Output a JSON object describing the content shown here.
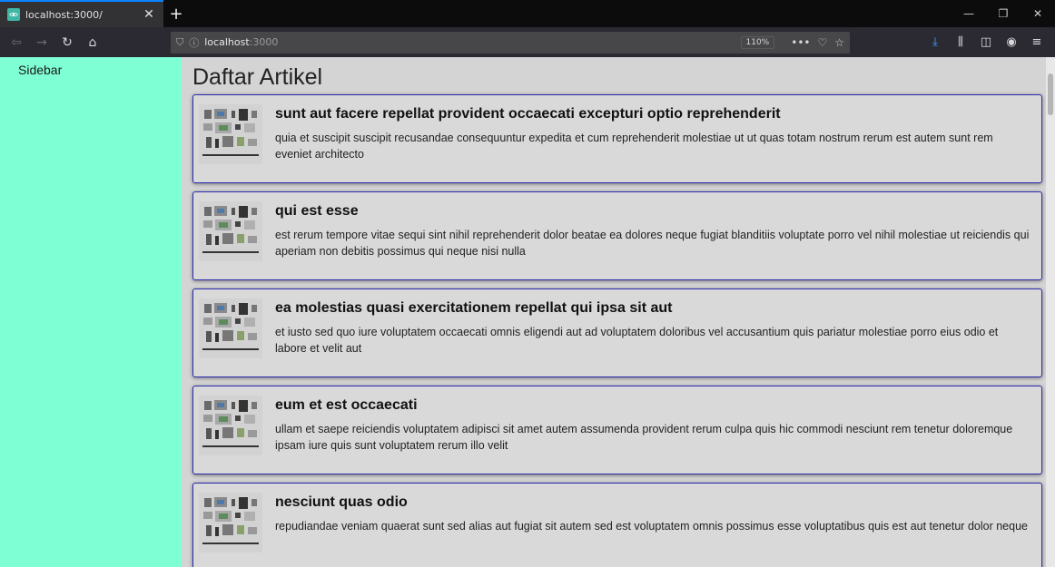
{
  "tab": {
    "title": "localhost:3000/"
  },
  "toolbar": {
    "url_host": "localhost",
    "url_port": ":3000",
    "zoom": "110%"
  },
  "sidebar": {
    "label": "Sidebar"
  },
  "page": {
    "title": "Daftar Artikel"
  },
  "articles": [
    {
      "title": "sunt aut facere repellat provident occaecati excepturi optio reprehenderit",
      "body": "quia et suscipit suscipit recusandae consequuntur expedita et cum reprehenderit molestiae ut ut quas totam nostrum rerum est autem sunt rem eveniet architecto"
    },
    {
      "title": "qui est esse",
      "body": "est rerum tempore vitae sequi sint nihil reprehenderit dolor beatae ea dolores neque fugiat blanditiis voluptate porro vel nihil molestiae ut reiciendis qui aperiam non debitis possimus qui neque nisi nulla"
    },
    {
      "title": "ea molestias quasi exercitationem repellat qui ipsa sit aut",
      "body": "et iusto sed quo iure voluptatem occaecati omnis eligendi aut ad voluptatem doloribus vel accusantium quis pariatur molestiae porro eius odio et labore et velit aut"
    },
    {
      "title": "eum et est occaecati",
      "body": "ullam et saepe reiciendis voluptatem adipisci sit amet autem assumenda provident rerum culpa quis hic commodi nesciunt rem tenetur doloremque ipsam iure quis sunt voluptatem rerum illo velit"
    },
    {
      "title": "nesciunt quas odio",
      "body": "repudiandae veniam quaerat sunt sed alias aut fugiat sit autem sed est voluptatem omnis possimus esse voluptatibus quis est aut tenetur dolor neque"
    }
  ],
  "colors": {
    "sidebar": "#7fffd4",
    "card_border": "#2b2bb0",
    "page_bg": "#d4d4d4"
  }
}
